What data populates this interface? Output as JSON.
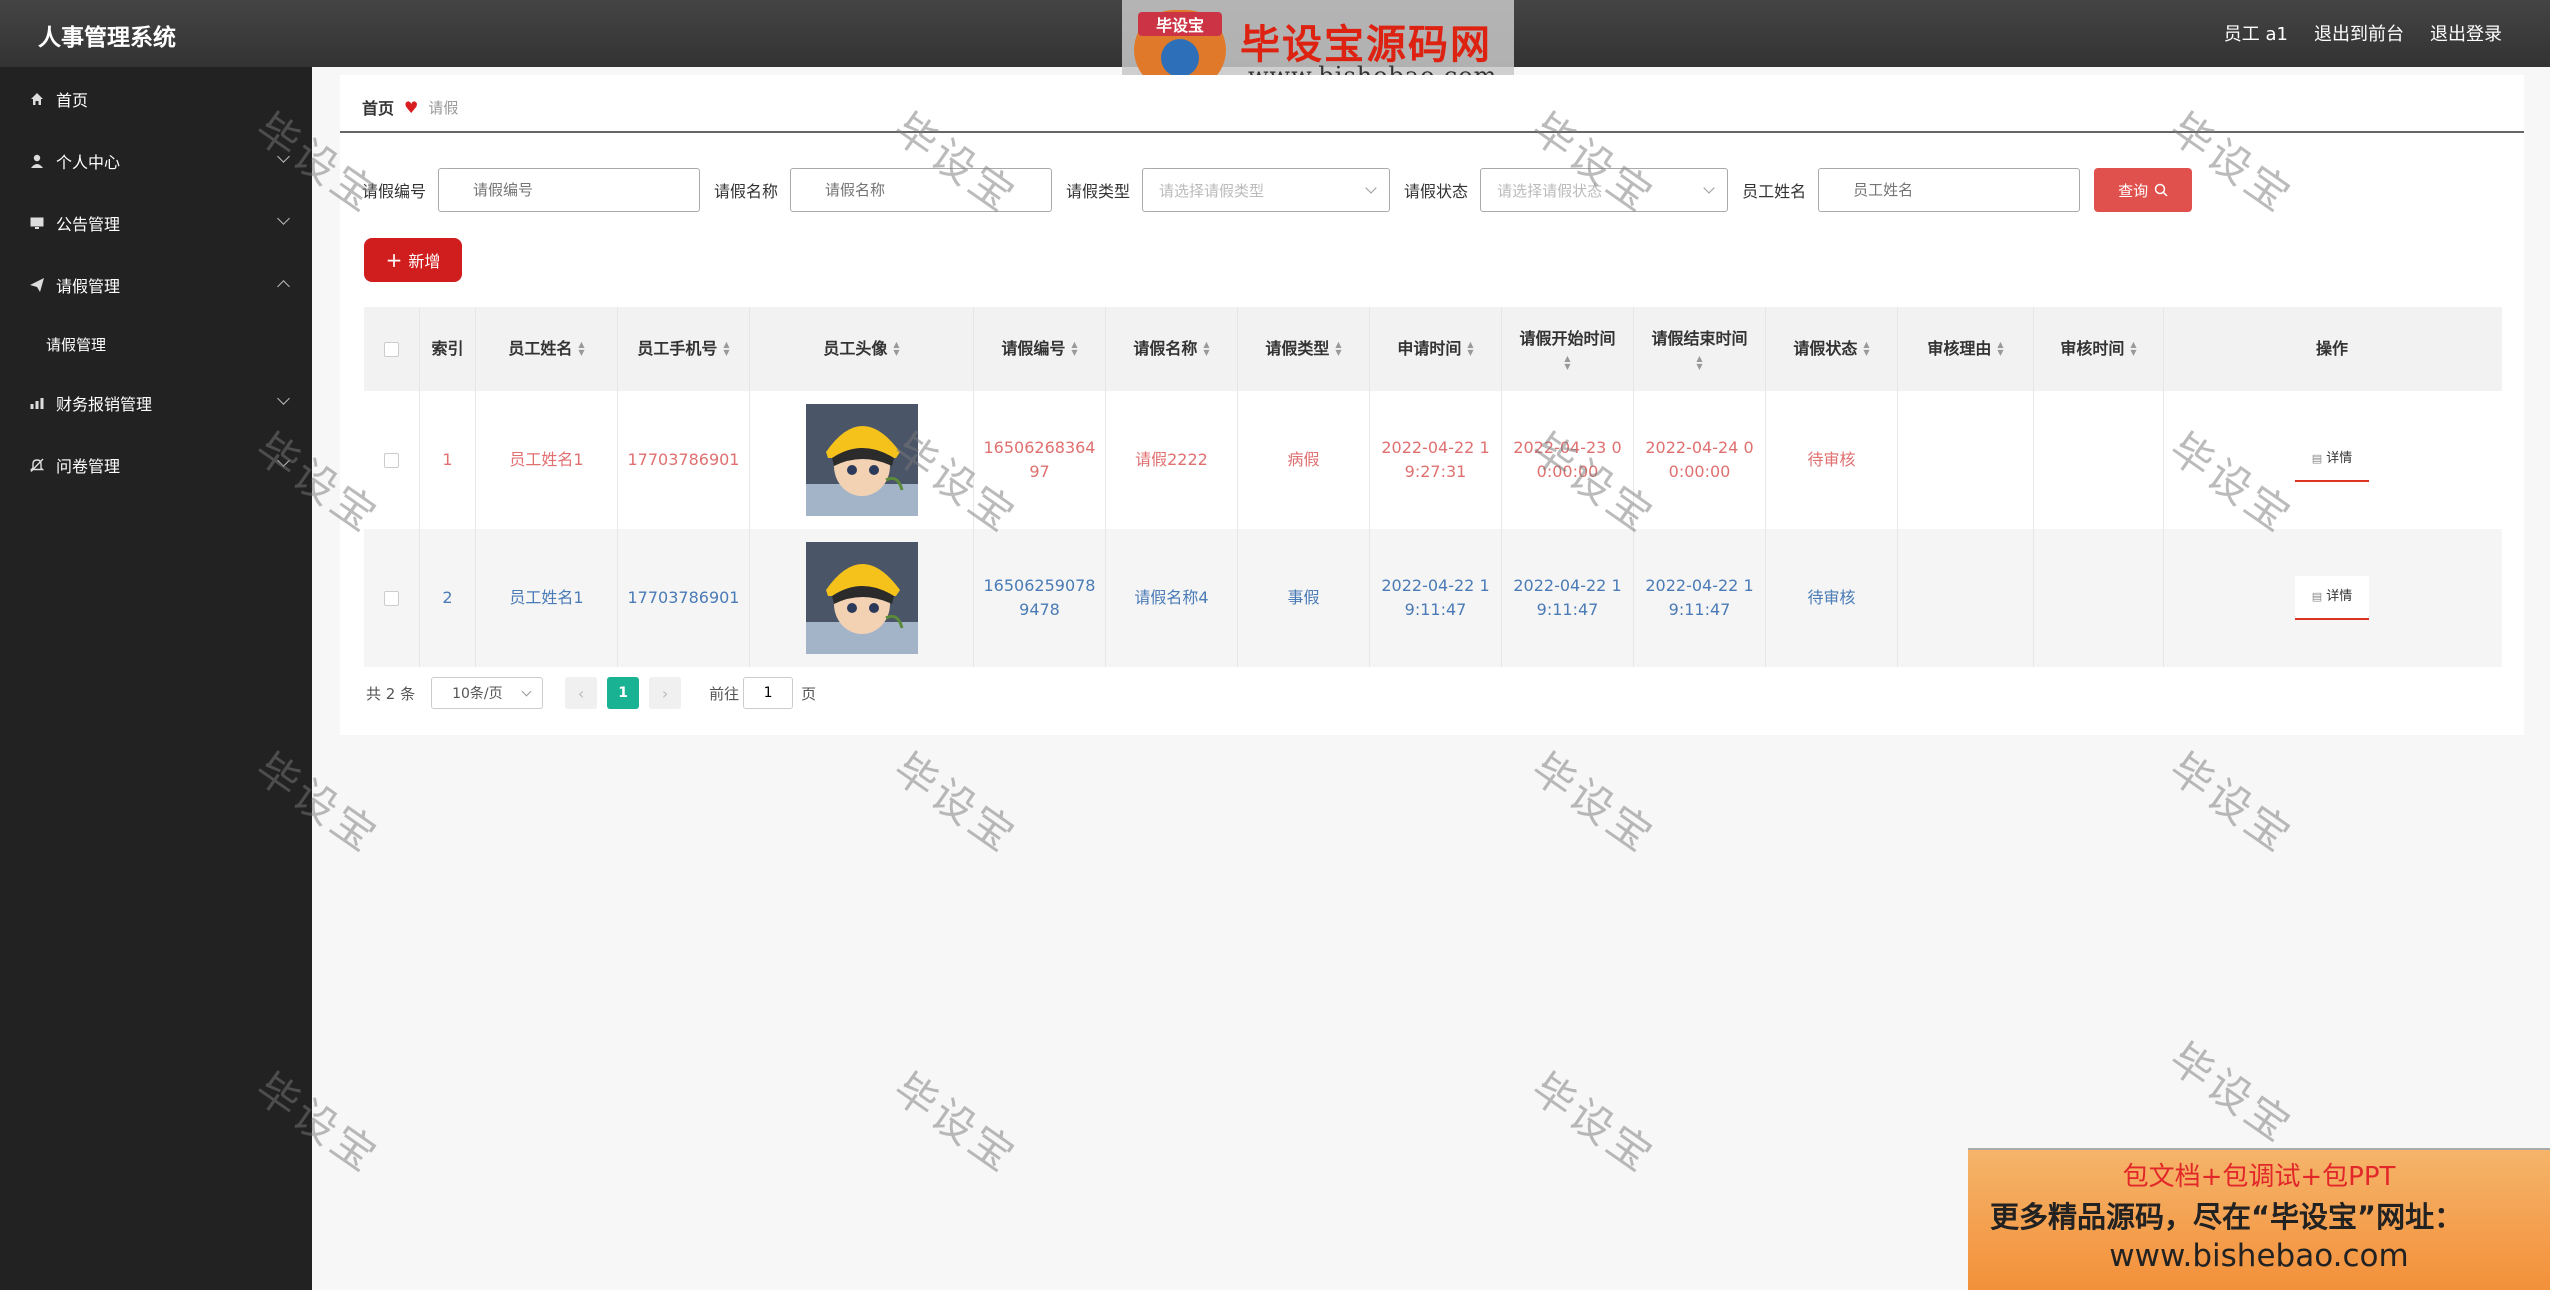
{
  "app": {
    "title": "人事管理系统",
    "top_actions": [
      "员工 a1",
      "退出到前台",
      "退出登录"
    ]
  },
  "watermark_banner": {
    "badge": "毕设宝",
    "name": "毕设宝源码网",
    "url": "www.bishebao.com"
  },
  "sidebar": {
    "items": [
      {
        "label": "首页",
        "icon": "home-icon"
      },
      {
        "label": "个人中心",
        "icon": "user-icon"
      },
      {
        "label": "公告管理",
        "icon": "monitor-icon"
      },
      {
        "label": "请假管理",
        "icon": "send-icon",
        "expanded": true
      },
      {
        "label": "请假管理"
      },
      {
        "label": "财务报销管理",
        "icon": "chart-icon"
      },
      {
        "label": "问卷管理",
        "icon": "bell-icon"
      }
    ]
  },
  "breadcrumb": {
    "home": "首页",
    "current": "请假"
  },
  "filters": {
    "leave_no_label": "请假编号",
    "leave_no_placeholder": "请假编号",
    "leave_name_label": "请假名称",
    "leave_name_placeholder": "请假名称",
    "leave_type_label": "请假类型",
    "leave_type_placeholder": "请选择请假类型",
    "leave_status_label": "请假状态",
    "leave_status_placeholder": "请选择请假状态",
    "employee_name_label": "员工姓名",
    "employee_name_placeholder": "员工姓名",
    "query_label": "查询"
  },
  "add_button": "新增",
  "table": {
    "headers": [
      "索引",
      "员工姓名",
      "员工手机号",
      "员工头像",
      "请假编号",
      "请假名称",
      "请假类型",
      "申请时间",
      "请假开始时间",
      "请假结束时间",
      "请假状态",
      "审核理由",
      "审核时间",
      "操作"
    ],
    "rows": [
      {
        "index": "1",
        "name": "员工姓名1",
        "phone": "17703786901",
        "leave_no": "1650626836497",
        "leave_name": "请假2222",
        "leave_type": "病假",
        "apply_time": "2022-04-22 19:27:31",
        "start_time": "2022-04-23 00:00:00",
        "end_time": "2022-04-24 00:00:00",
        "status": "待审核",
        "reason": "",
        "audit_time": "",
        "action": "详情"
      },
      {
        "index": "2",
        "name": "员工姓名1",
        "phone": "17703786901",
        "leave_no": "16506259078 9478",
        "leave_name": "请假名称4",
        "leave_type": "事假",
        "apply_time": "2022-04-22 19:11:47",
        "start_time": "2022-04-22 19:11:47",
        "end_time": "2022-04-22 19:11:47",
        "status": "待审核",
        "reason": "",
        "audit_time": "",
        "action": "详情"
      }
    ]
  },
  "pagination": {
    "total": "共 2 条",
    "page_size": "10条/页",
    "current": "1",
    "goto_prefix": "前往",
    "goto_value": "1",
    "goto_suffix": "页"
  },
  "watermark_text": "毕设宝",
  "ad": {
    "line1": "包文档+包调试+包PPT",
    "line2": "更多精品源码，尽在“毕设宝”网址：",
    "line3": "www.bishebao.com"
  },
  "colors": {
    "topbar": "#3a3a3a",
    "sidebar": "#222222",
    "primary_red": "#d01d1d",
    "query_red": "#e0504d",
    "pager_active": "#19b394",
    "row_red_text": "#e07070",
    "row_blue_text": "#4a7bb6"
  }
}
